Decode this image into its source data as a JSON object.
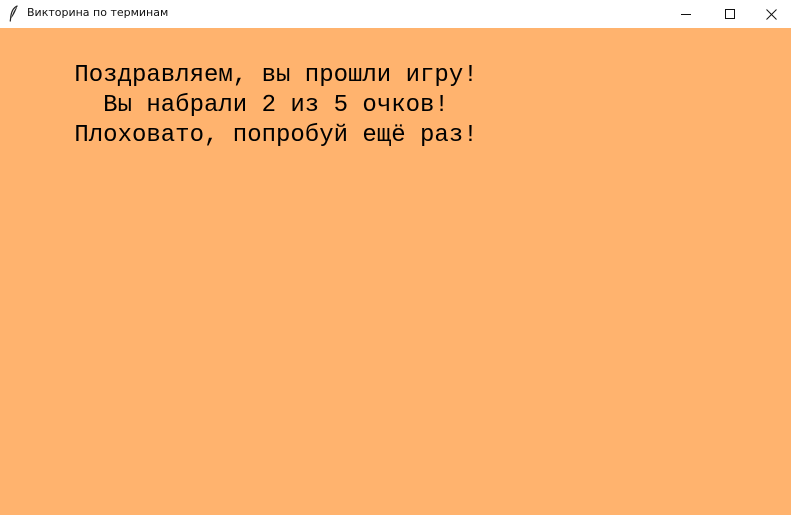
{
  "window": {
    "title": "Викторина по терминам",
    "app_icon": "feather-icon",
    "controls": [
      "minimize-icon",
      "maximize-icon",
      "close-icon"
    ]
  },
  "colors": {
    "background": "#ffb36e",
    "titlebar": "#ffffff",
    "text": "#000000"
  },
  "result": {
    "line1": "Поздравляем, вы прошли игру!",
    "line2": "Вы набрали 2 из 5 очков!",
    "line3": "Плоховато, попробуй ещё раз!",
    "score": 2,
    "max_score": 5
  }
}
